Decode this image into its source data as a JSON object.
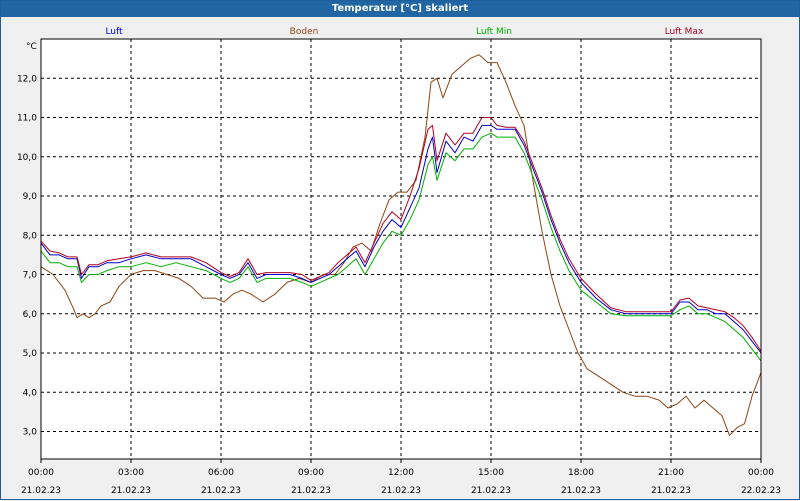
{
  "window": {
    "title": "Temperatur [°C] skaliert"
  },
  "chart_data": {
    "type": "line",
    "title": "Temperatur [°C] skaliert",
    "ylabel": "°C",
    "ylim": [
      2.3,
      13.0
    ],
    "yticks": [
      3.0,
      4.0,
      5.0,
      6.0,
      7.0,
      8.0,
      9.0,
      10.0,
      11.0,
      12.0
    ],
    "ytick_labels": [
      "3,0",
      "4,0",
      "5,0",
      "6,0",
      "7,0",
      "8,0",
      "9,0",
      "10,0",
      "11,0",
      "12,0"
    ],
    "xlim": [
      0,
      24
    ],
    "xticks": [
      0,
      3,
      6,
      9,
      12,
      15,
      18,
      21,
      24
    ],
    "xtick_labels": [
      [
        "00:00",
        "21.02.23"
      ],
      [
        "03:00",
        "21.02.23"
      ],
      [
        "06:00",
        "21.02.23"
      ],
      [
        "09:00",
        "21.02.23"
      ],
      [
        "12:00",
        "21.02.23"
      ],
      [
        "15:00",
        "21.02.23"
      ],
      [
        "18:00",
        "21.02.23"
      ],
      [
        "21:00",
        "21.02.23"
      ],
      [
        "00:00",
        "22.02.23"
      ]
    ],
    "grid": true,
    "legend_position": "top",
    "x_unit": "hours since 21.02.23 00:00",
    "series": [
      {
        "name": "Luft",
        "color": "#0000cc",
        "x": [
          0,
          0.3,
          0.6,
          0.9,
          1.2,
          1.35,
          1.6,
          1.9,
          2.2,
          2.6,
          3.0,
          3.5,
          4.0,
          4.5,
          5.0,
          5.5,
          6.0,
          6.3,
          6.6,
          6.9,
          7.2,
          7.5,
          7.9,
          8.3,
          8.7,
          9.0,
          9.3,
          9.6,
          9.9,
          10.2,
          10.5,
          10.8,
          11.1,
          11.4,
          11.7,
          12.0,
          12.3,
          12.6,
          12.9,
          13.05,
          13.2,
          13.5,
          13.8,
          14.1,
          14.4,
          14.7,
          15.0,
          15.2,
          15.5,
          15.8,
          16.1,
          16.4,
          16.7,
          17.0,
          17.3,
          17.6,
          18.0,
          18.5,
          19.0,
          19.5,
          20.0,
          20.5,
          21.0,
          21.3,
          21.6,
          21.9,
          22.2,
          22.5,
          22.8,
          23.1,
          23.4,
          23.7,
          24.0
        ],
        "y": [
          7.8,
          7.5,
          7.5,
          7.4,
          7.4,
          6.9,
          7.2,
          7.2,
          7.3,
          7.3,
          7.4,
          7.5,
          7.4,
          7.4,
          7.4,
          7.2,
          7.0,
          6.9,
          7.0,
          7.3,
          6.9,
          7.0,
          7.0,
          7.0,
          6.9,
          6.8,
          6.9,
          7.0,
          7.2,
          7.4,
          7.6,
          7.2,
          7.7,
          8.1,
          8.4,
          8.2,
          8.7,
          9.2,
          10.2,
          10.5,
          9.6,
          10.4,
          10.1,
          10.5,
          10.4,
          10.8,
          10.8,
          10.7,
          10.7,
          10.7,
          10.3,
          9.7,
          9.1,
          8.4,
          7.8,
          7.3,
          6.8,
          6.4,
          6.1,
          6.0,
          6.0,
          6.0,
          6.0,
          6.3,
          6.3,
          6.1,
          6.1,
          6.0,
          6.0,
          5.8,
          5.6,
          5.3,
          5.0
        ]
      },
      {
        "name": "Boden",
        "color": "#8b4513",
        "x": [
          0,
          0.4,
          0.8,
          1.1,
          1.2,
          1.4,
          1.6,
          1.8,
          2.0,
          2.3,
          2.6,
          3.0,
          3.4,
          3.8,
          4.2,
          4.6,
          5.0,
          5.4,
          5.8,
          6.1,
          6.4,
          6.7,
          7.0,
          7.4,
          7.8,
          8.2,
          8.6,
          9.0,
          9.4,
          9.8,
          10.1,
          10.4,
          10.7,
          11.0,
          11.3,
          11.6,
          11.9,
          12.2,
          12.5,
          12.8,
          13.0,
          13.2,
          13.4,
          13.7,
          14.0,
          14.3,
          14.6,
          14.9,
          15.2,
          15.5,
          15.8,
          16.1,
          16.4,
          16.7,
          17.0,
          17.3,
          17.6,
          17.9,
          18.2,
          18.6,
          19.0,
          19.4,
          19.8,
          20.2,
          20.6,
          20.9,
          21.2,
          21.5,
          21.8,
          22.1,
          22.4,
          22.7,
          22.95,
          23.2,
          23.45,
          23.7,
          24.0
        ],
        "y": [
          7.2,
          7.0,
          6.6,
          6.1,
          5.9,
          6.0,
          5.9,
          6.0,
          6.2,
          6.3,
          6.7,
          7.0,
          7.1,
          7.1,
          7.0,
          6.9,
          6.7,
          6.4,
          6.4,
          6.3,
          6.5,
          6.6,
          6.5,
          6.3,
          6.5,
          6.8,
          6.9,
          6.8,
          7.0,
          7.0,
          7.3,
          7.7,
          7.8,
          7.6,
          8.3,
          8.9,
          9.1,
          9.1,
          9.4,
          10.5,
          11.9,
          12.0,
          11.5,
          12.1,
          12.3,
          12.5,
          12.6,
          12.4,
          12.4,
          11.9,
          11.3,
          10.8,
          9.4,
          8.1,
          7.0,
          6.2,
          5.6,
          5.0,
          4.6,
          4.4,
          4.2,
          4.0,
          3.9,
          3.9,
          3.8,
          3.6,
          3.7,
          3.9,
          3.6,
          3.8,
          3.6,
          3.4,
          2.9,
          3.1,
          3.2,
          3.9,
          4.5
        ]
      },
      {
        "name": "Luft Min",
        "color": "#00b000",
        "x": [
          0,
          0.3,
          0.6,
          0.9,
          1.2,
          1.35,
          1.6,
          1.9,
          2.2,
          2.6,
          3.0,
          3.5,
          4.0,
          4.5,
          5.0,
          5.5,
          6.0,
          6.3,
          6.6,
          6.9,
          7.2,
          7.5,
          7.9,
          8.3,
          8.7,
          9.0,
          9.3,
          9.6,
          9.9,
          10.2,
          10.5,
          10.8,
          11.1,
          11.4,
          11.7,
          12.0,
          12.3,
          12.6,
          12.9,
          13.05,
          13.2,
          13.5,
          13.8,
          14.1,
          14.4,
          14.7,
          15.0,
          15.2,
          15.5,
          15.8,
          16.1,
          16.4,
          16.7,
          17.0,
          17.3,
          17.6,
          18.0,
          18.5,
          19.0,
          19.5,
          20.0,
          20.5,
          21.0,
          21.3,
          21.6,
          21.9,
          22.2,
          22.5,
          22.8,
          23.1,
          23.4,
          23.7,
          24.0
        ],
        "y": [
          7.6,
          7.3,
          7.3,
          7.2,
          7.2,
          6.8,
          7.0,
          7.0,
          7.1,
          7.2,
          7.2,
          7.3,
          7.2,
          7.3,
          7.2,
          7.1,
          6.9,
          6.8,
          6.9,
          7.2,
          6.8,
          6.9,
          6.9,
          6.9,
          6.8,
          6.7,
          6.8,
          6.9,
          7.0,
          7.2,
          7.4,
          7.0,
          7.4,
          7.8,
          8.1,
          8.0,
          8.4,
          8.9,
          9.8,
          10.0,
          9.4,
          10.1,
          9.9,
          10.2,
          10.2,
          10.5,
          10.6,
          10.5,
          10.5,
          10.5,
          10.1,
          9.5,
          8.9,
          8.2,
          7.6,
          7.1,
          6.6,
          6.3,
          6.0,
          5.95,
          5.95,
          5.95,
          5.95,
          6.1,
          6.2,
          6.0,
          6.0,
          5.9,
          5.8,
          5.6,
          5.4,
          5.1,
          4.8
        ]
      },
      {
        "name": "Luft Max",
        "color": "#b00020",
        "x": [
          0,
          0.3,
          0.6,
          0.9,
          1.2,
          1.35,
          1.6,
          1.9,
          2.2,
          2.6,
          3.0,
          3.5,
          4.0,
          4.5,
          5.0,
          5.5,
          6.0,
          6.3,
          6.6,
          6.9,
          7.2,
          7.5,
          7.9,
          8.3,
          8.7,
          9.0,
          9.3,
          9.6,
          9.9,
          10.2,
          10.5,
          10.8,
          11.1,
          11.4,
          11.7,
          12.0,
          12.3,
          12.6,
          12.9,
          13.05,
          13.2,
          13.5,
          13.8,
          14.1,
          14.4,
          14.7,
          15.0,
          15.2,
          15.5,
          15.8,
          16.1,
          16.4,
          16.7,
          17.0,
          17.3,
          17.6,
          18.0,
          18.5,
          19.0,
          19.5,
          20.0,
          20.5,
          21.0,
          21.3,
          21.6,
          21.9,
          22.2,
          22.5,
          22.8,
          23.1,
          23.4,
          23.7,
          24.0
        ],
        "y": [
          7.85,
          7.6,
          7.55,
          7.45,
          7.45,
          7.0,
          7.25,
          7.25,
          7.35,
          7.4,
          7.45,
          7.55,
          7.45,
          7.45,
          7.45,
          7.3,
          7.05,
          6.95,
          7.05,
          7.4,
          7.0,
          7.05,
          7.05,
          7.05,
          7.0,
          6.85,
          6.95,
          7.05,
          7.3,
          7.5,
          7.7,
          7.3,
          7.8,
          8.3,
          8.6,
          8.4,
          9.0,
          9.7,
          10.7,
          10.8,
          9.9,
          10.6,
          10.3,
          10.6,
          10.6,
          11.0,
          11.0,
          10.8,
          10.75,
          10.75,
          10.4,
          9.8,
          9.2,
          8.5,
          7.9,
          7.4,
          6.9,
          6.5,
          6.15,
          6.05,
          6.05,
          6.05,
          6.05,
          6.35,
          6.4,
          6.2,
          6.15,
          6.1,
          6.05,
          5.9,
          5.7,
          5.4,
          5.05
        ]
      }
    ]
  }
}
